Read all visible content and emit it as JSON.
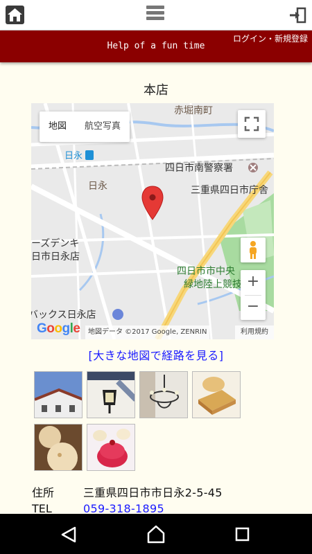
{
  "header": {
    "home_icon": "home-icon",
    "menu_icon": "hamburger-menu-icon",
    "login_icon": "login-arrow-icon"
  },
  "banner": {
    "title": "Help of a fun time",
    "login_link": "ログイン・新規登録",
    "color": "#8b0000"
  },
  "section": {
    "title": "本店"
  },
  "map": {
    "type_controls": [
      "地図",
      "航空写真"
    ],
    "labels": {
      "akahori": "赤堀南町",
      "hinaga_station": "日永",
      "hinaga": "日永",
      "police": "四日市南警察署",
      "pref_office": "三重県四日市庁舎",
      "denki": "ーズデンキ",
      "denki2": "日市日永店",
      "park": "四日市市中央",
      "park2": "緑地陸上競技場",
      "bakkusu": "バックス日永店"
    },
    "attribution": "地図データ ©2017 Google, ZENRIN",
    "terms": "利用規約",
    "zoom_in": "+",
    "zoom_out": "−",
    "logo": "Google"
  },
  "map_link": "[大きな地図で経路を見る]",
  "photos": [
    {
      "name": "building-exterior-photo"
    },
    {
      "name": "wall-lamp-photo"
    },
    {
      "name": "chandelier-photo"
    },
    {
      "name": "pastry-photo"
    },
    {
      "name": "bread-rolls-photo"
    },
    {
      "name": "strawberry-cake-photo"
    }
  ],
  "info": {
    "address_label": "住所",
    "address_value": "三重県四日市市日永2-5-45",
    "tel_label": "TEL",
    "tel_value": "059-318-1895"
  },
  "navbar": {
    "back_icon": "back-triangle-icon",
    "home_icon": "home-circle-icon",
    "recents_icon": "recents-square-icon"
  }
}
